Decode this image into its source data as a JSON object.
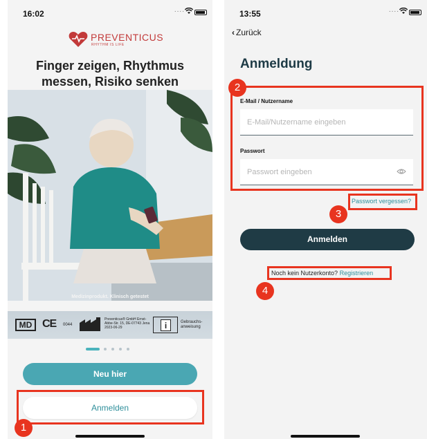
{
  "left_screen": {
    "status": {
      "time": "16:02",
      "dots": "...."
    },
    "logo": {
      "name": "PREVENTICUS",
      "tagline": "RHYTHM IS LIFE"
    },
    "headline": "Finger zeigen, Rhythmus messen, Risiko senken",
    "photo_caption": "Medizinprodukt. Klinisch getestet",
    "regulatory": {
      "md": "MD",
      "ce": "CE",
      "ce_number": "0044",
      "manufacturer": "Preventicus® GmbH Ernst-Abbe-Str. 15, DE-07743 Jena 2023-06-29",
      "ifu_label": "Gebrauchs-anweisung",
      "ifu_icon": "i"
    },
    "pager": {
      "count": 5,
      "active": 0
    },
    "buttons": {
      "neu_hier": "Neu hier",
      "anmelden": "Anmelden"
    }
  },
  "right_screen": {
    "status": {
      "time": "13:55",
      "dots": "...."
    },
    "back_label": "Zurück",
    "title": "Anmeldung",
    "email_label": "E-Mail / Nutzername",
    "email_placeholder": "E-Mail/Nutzername eingeben",
    "password_label": "Passwort",
    "password_placeholder": "Passwort eingeben",
    "forgot_password": "Passwort vergessen?",
    "login_button": "Anmelden",
    "no_account_text": "Noch kein Nutzerkonto?",
    "register_link": "Registrieren"
  },
  "annotations": {
    "badge1": "1",
    "badge2": "2",
    "badge3": "3",
    "badge4": "4"
  },
  "colors": {
    "accent_teal": "#4aa7b3",
    "dark_button": "#1f3b45",
    "annotation_red": "#e8341f",
    "brand_red": "#c23a3a"
  },
  "icons": [
    "wifi-icon",
    "battery-icon",
    "heart-logo-icon",
    "factory-icon",
    "info-manual-icon",
    "chevron-left-icon",
    "eye-icon"
  ]
}
